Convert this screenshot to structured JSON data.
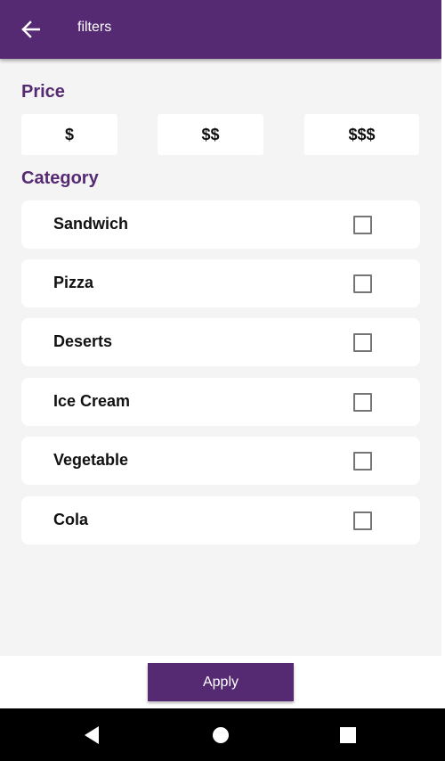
{
  "appbar": {
    "title": "filters",
    "back_icon": "arrow-left-icon"
  },
  "price": {
    "title": "Price",
    "options": [
      "$",
      "$$",
      "$$$"
    ]
  },
  "category": {
    "title": "Category",
    "items": [
      {
        "label": "Sandwich",
        "checked": false
      },
      {
        "label": "Pizza",
        "checked": false
      },
      {
        "label": "Deserts",
        "checked": false
      },
      {
        "label": "Ice Cream",
        "checked": false
      },
      {
        "label": "Vegetable",
        "checked": false
      },
      {
        "label": "Cola",
        "checked": false
      }
    ]
  },
  "footer": {
    "apply_label": "Apply"
  },
  "colors": {
    "primary": "#552a72",
    "background": "#f4f4f4",
    "card": "#ffffff"
  },
  "system_nav": {
    "icons": [
      "nav-back-icon",
      "nav-home-icon",
      "nav-recents-icon"
    ]
  }
}
